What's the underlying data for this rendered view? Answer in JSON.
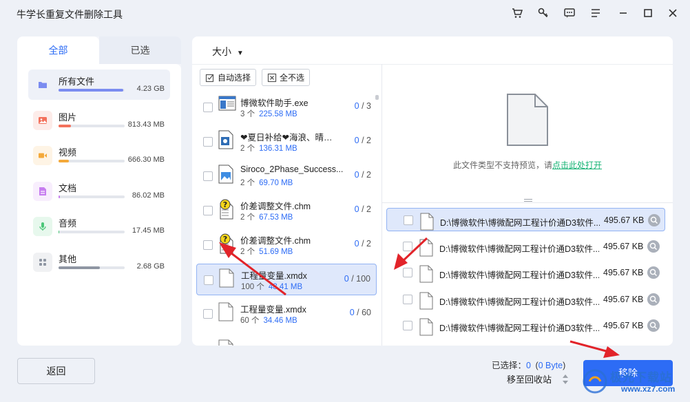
{
  "app": {
    "title": "牛学长重复文件删除工具"
  },
  "tabs": {
    "all": "全部",
    "selected": "已选"
  },
  "categories": [
    {
      "name": "所有文件",
      "size": "4.23 GB",
      "color": "#7b8cf0",
      "fill": 0.98,
      "icon": "folder-icon"
    },
    {
      "name": "图片",
      "size": "813.43 MB",
      "color": "#f3715c",
      "fill": 0.19,
      "icon": "image-icon"
    },
    {
      "name": "视频",
      "size": "666.30 MB",
      "color": "#f4a93a",
      "fill": 0.16,
      "icon": "video-icon"
    },
    {
      "name": "文档",
      "size": "86.02 MB",
      "color": "#c77ef0",
      "fill": 0.02,
      "icon": "document-icon"
    },
    {
      "name": "音频",
      "size": "17.45 MB",
      "color": "#4cc779",
      "fill": 0.005,
      "icon": "audio-icon"
    },
    {
      "name": "其他",
      "size": "2.68 GB",
      "color": "#8f96a3",
      "fill": 0.63,
      "icon": "other-icon"
    }
  ],
  "sort": {
    "label": "大小"
  },
  "toolbar": {
    "auto_select": "自动选择",
    "deselect_all": "全不选"
  },
  "files": [
    {
      "name": "博微软件助手.exe",
      "count": "3 个",
      "size": "225.58 MB",
      "selected": "0",
      "total": "3",
      "icon": "exe-icon"
    },
    {
      "name": "❤夏日补给❤海浪、晴…",
      "count": "2 个",
      "size": "136.31 MB",
      "selected": "0",
      "total": "2",
      "icon": "media-file-icon"
    },
    {
      "name": "Siroco_2Phase_Success....",
      "count": "2 个",
      "size": "69.70 MB",
      "selected": "0",
      "total": "2",
      "icon": "image-file-icon"
    },
    {
      "name": "价差调整文件.chm",
      "count": "2 个",
      "size": "67.53 MB",
      "selected": "0",
      "total": "2",
      "icon": "chm-file-icon"
    },
    {
      "name": "价差调整文件.chm",
      "count": "2 个",
      "size": "51.69 MB",
      "selected": "0",
      "total": "2",
      "icon": "chm-file-icon"
    },
    {
      "name": "工程量变量.xmdx",
      "count": "100 个",
      "size": "48.41 MB",
      "selected": "0",
      "total": "100",
      "icon": "blank-file-icon"
    },
    {
      "name": "工程量变量.xmdx",
      "count": "60 个",
      "size": "34.46 MB",
      "selected": "0",
      "total": "60",
      "icon": "blank-file-icon"
    }
  ],
  "preview": {
    "text": "此文件类型不支持预览，请",
    "link": "点击此处打开"
  },
  "duplicates": [
    {
      "path": "D:\\博微软件\\博微配网工程计价通D3软件...",
      "size": "495.67 KB"
    },
    {
      "path": "D:\\博微软件\\博微配网工程计价通D3软件...",
      "size": "495.67 KB"
    },
    {
      "path": "D:\\博微软件\\博微配网工程计价通D3软件...",
      "size": "495.67 KB"
    },
    {
      "path": "D:\\博微软件\\博微配网工程计价通D3软件...",
      "size": "495.67 KB"
    },
    {
      "path": "D:\\博微软件\\博微配网工程计价通D3软件...",
      "size": "495.67 KB"
    }
  ],
  "footer": {
    "back": "返回",
    "selected_label": "已选择：",
    "selected_count": "0",
    "selected_bytes": "0 Byte",
    "recycle": "移至回收站",
    "remove": "移除"
  },
  "watermark": {
    "text": "极光下载站",
    "url": "www.xz7.com"
  }
}
